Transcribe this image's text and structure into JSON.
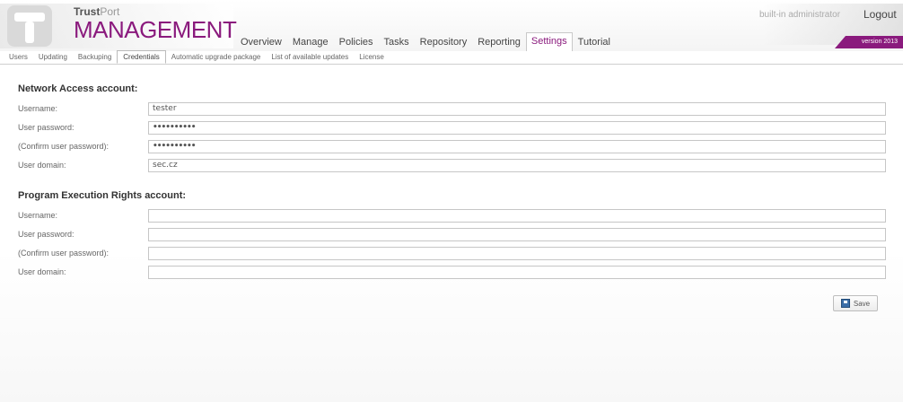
{
  "brand": {
    "top_bold": "Trust",
    "top_light": "Port",
    "product": "MANAGEMENT"
  },
  "nav": {
    "items": [
      {
        "label": "Overview"
      },
      {
        "label": "Manage"
      },
      {
        "label": "Policies"
      },
      {
        "label": "Tasks"
      },
      {
        "label": "Repository"
      },
      {
        "label": "Reporting"
      },
      {
        "label": "Settings",
        "active": true
      },
      {
        "label": "Tutorial"
      }
    ]
  },
  "user": {
    "label": "built-in administrator",
    "logout": "Logout",
    "version": "version 2013"
  },
  "subnav": {
    "items": [
      {
        "label": "Users"
      },
      {
        "label": "Updating"
      },
      {
        "label": "Backuping"
      },
      {
        "label": "Credentials",
        "active": true
      },
      {
        "label": "Automatic upgrade package"
      },
      {
        "label": "List of available updates"
      },
      {
        "label": "License"
      }
    ]
  },
  "network_account": {
    "title": "Network Access account:",
    "rows": [
      {
        "label": "Username:",
        "value": "tester"
      },
      {
        "label": "User password:",
        "value": "••••••••••"
      },
      {
        "label": "(Confirm user password):",
        "value": "••••••••••"
      },
      {
        "label": "User domain:",
        "value": "sec.cz"
      }
    ]
  },
  "program_account": {
    "title": "Program Execution Rights account:",
    "rows": [
      {
        "label": "Username:",
        "value": ""
      },
      {
        "label": "User password:",
        "value": ""
      },
      {
        "label": "(Confirm user password):",
        "value": ""
      },
      {
        "label": "User domain:",
        "value": ""
      }
    ]
  },
  "actions": {
    "save": "Save"
  },
  "colors": {
    "brand": "#8a1a7d",
    "border": "#c6c6c6"
  }
}
